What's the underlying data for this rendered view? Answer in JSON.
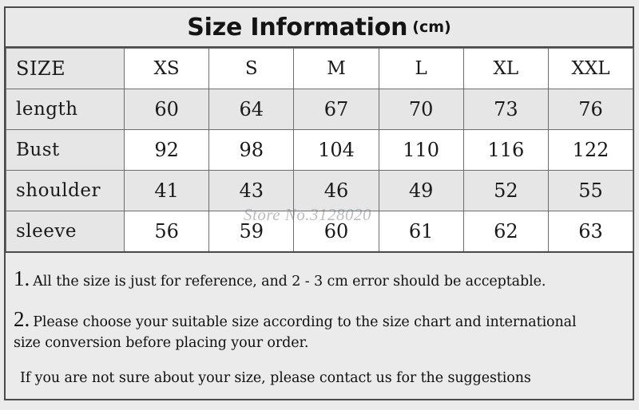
{
  "title": {
    "main": "Size Information",
    "unit": "(cm)"
  },
  "table": {
    "header": {
      "label": "SIZE",
      "sizes": [
        "XS",
        "S",
        "M",
        "L",
        "XL",
        "XXL"
      ]
    },
    "rows": [
      {
        "label": "length",
        "values": [
          "60",
          "64",
          "67",
          "70",
          "73",
          "76"
        ]
      },
      {
        "label": "Bust",
        "values": [
          "92",
          "98",
          "104",
          "110",
          "116",
          "122"
        ]
      },
      {
        "label": "shoulder",
        "values": [
          "41",
          "43",
          "46",
          "49",
          "52",
          "55"
        ]
      },
      {
        "label": "sleeve",
        "values": [
          "56",
          "59",
          "60",
          "61",
          "62",
          "63"
        ]
      }
    ]
  },
  "watermark": "Store No.3128020",
  "notes": [
    {
      "number": "1.",
      "text": "All the size is just for reference, and 2 - 3 cm error should be acceptable."
    },
    {
      "number": "2.",
      "text": "Please choose your suitable size according to the size chart and international",
      "continuation": "size conversion before placing your order."
    }
  ],
  "closing_note": "If you are not sure about your size, please contact us for the suggestions",
  "colors": {
    "page_background": "#ebebeb",
    "shaded_cell": "#e6e6e6",
    "plain_cell": "#ffffff",
    "border": "#4a4a4a",
    "grid_line": "#6e6e6e",
    "text": "#1a1a1a"
  }
}
